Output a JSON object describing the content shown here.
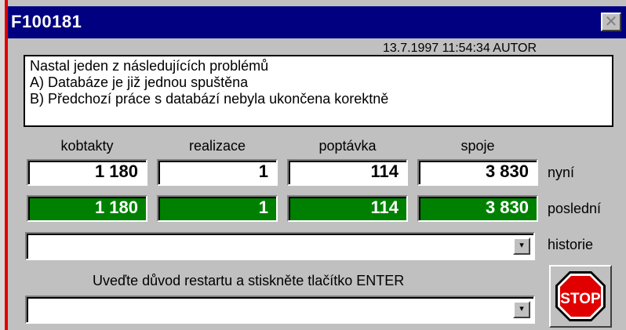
{
  "window": {
    "title": "F100181",
    "close_glyph": "✕"
  },
  "timestamp": "13.7.1997 11:54:34 AUTOR",
  "message": {
    "lines": [
      "Nastal jeden z následujících problémů",
      "A) Databáze je již jednou spuštěna",
      "B) Předchozí práce s databází nebyla ukončena korektně"
    ]
  },
  "columns": [
    "kobtakty",
    "realizace",
    "poptávka",
    "spoje"
  ],
  "current": {
    "label": "nyní",
    "values": [
      "1 180",
      "1",
      "114",
      "3 830"
    ]
  },
  "last": {
    "label": "poslední",
    "values": [
      "1 180",
      "1",
      "114",
      "3 830"
    ]
  },
  "history": {
    "label": "historie",
    "value": "",
    "dropdown_glyph": "▾"
  },
  "instruction": "Uveďte důvod restartu a stiskněte tlačítko ENTER",
  "reason": {
    "value": "",
    "dropdown_glyph": "▾"
  },
  "stop_button": {
    "label": "STOP",
    "icon": "stop-sign-icon"
  },
  "colors": {
    "titlebar": "#000080",
    "last_value_bg": "#008000",
    "stop_red": "#e00000",
    "dialog_bg": "#c0c0c0"
  }
}
